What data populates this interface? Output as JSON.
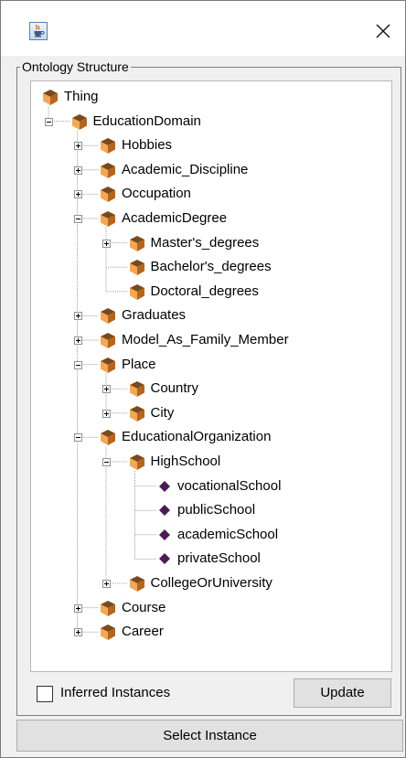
{
  "window": {
    "app_icon": "java-coffee-cup-icon",
    "close_icon": "close-icon"
  },
  "ontology": {
    "legend": "Ontology Structure",
    "tree": [
      {
        "label": "Thing",
        "kind": "class",
        "depth": 0,
        "expander": "none"
      },
      {
        "label": "EducationDomain",
        "kind": "class",
        "depth": 1,
        "expander": "minus"
      },
      {
        "label": "Hobbies",
        "kind": "class",
        "depth": 2,
        "expander": "plus"
      },
      {
        "label": "Academic_Discipline",
        "kind": "class",
        "depth": 2,
        "expander": "plus"
      },
      {
        "label": "Occupation",
        "kind": "class",
        "depth": 2,
        "expander": "plus"
      },
      {
        "label": "AcademicDegree",
        "kind": "class",
        "depth": 2,
        "expander": "minus"
      },
      {
        "label": "Master's_degrees",
        "kind": "class",
        "depth": 3,
        "expander": "plus"
      },
      {
        "label": "Bachelor's_degrees",
        "kind": "class",
        "depth": 3,
        "expander": "none"
      },
      {
        "label": "Doctoral_degrees",
        "kind": "class",
        "depth": 3,
        "expander": "none"
      },
      {
        "label": "Graduates",
        "kind": "class",
        "depth": 2,
        "expander": "plus"
      },
      {
        "label": "Model_As_Family_Member",
        "kind": "class",
        "depth": 2,
        "expander": "plus"
      },
      {
        "label": "Place",
        "kind": "class",
        "depth": 2,
        "expander": "minus"
      },
      {
        "label": "Country",
        "kind": "class",
        "depth": 3,
        "expander": "plus"
      },
      {
        "label": "City",
        "kind": "class",
        "depth": 3,
        "expander": "plus"
      },
      {
        "label": "EducationalOrganization",
        "kind": "class",
        "depth": 2,
        "expander": "minus"
      },
      {
        "label": "HighSchool",
        "kind": "class",
        "depth": 3,
        "expander": "minus"
      },
      {
        "label": "vocationalSchool",
        "kind": "instance",
        "depth": 4,
        "expander": "none"
      },
      {
        "label": "publicSchool",
        "kind": "instance",
        "depth": 4,
        "expander": "none"
      },
      {
        "label": "academicSchool",
        "kind": "instance",
        "depth": 4,
        "expander": "none"
      },
      {
        "label": "privateSchool",
        "kind": "instance",
        "depth": 4,
        "expander": "none"
      },
      {
        "label": "CollegeOrUniversity",
        "kind": "class",
        "depth": 3,
        "expander": "plus"
      },
      {
        "label": "Course",
        "kind": "class",
        "depth": 2,
        "expander": "plus"
      },
      {
        "label": "Career",
        "kind": "class",
        "depth": 2,
        "expander": "plus"
      }
    ]
  },
  "controls": {
    "inferred_label": "Inferred Instances",
    "inferred_checked": false,
    "update_label": "Update",
    "select_label": "Select Instance"
  },
  "colors": {
    "class_icon_light": "#f2a857",
    "class_icon_dark": "#b5651d",
    "class_icon_top": "#7a4a1c",
    "instance_icon": "#4b1d52",
    "tree_line": "#a0a0a0"
  }
}
